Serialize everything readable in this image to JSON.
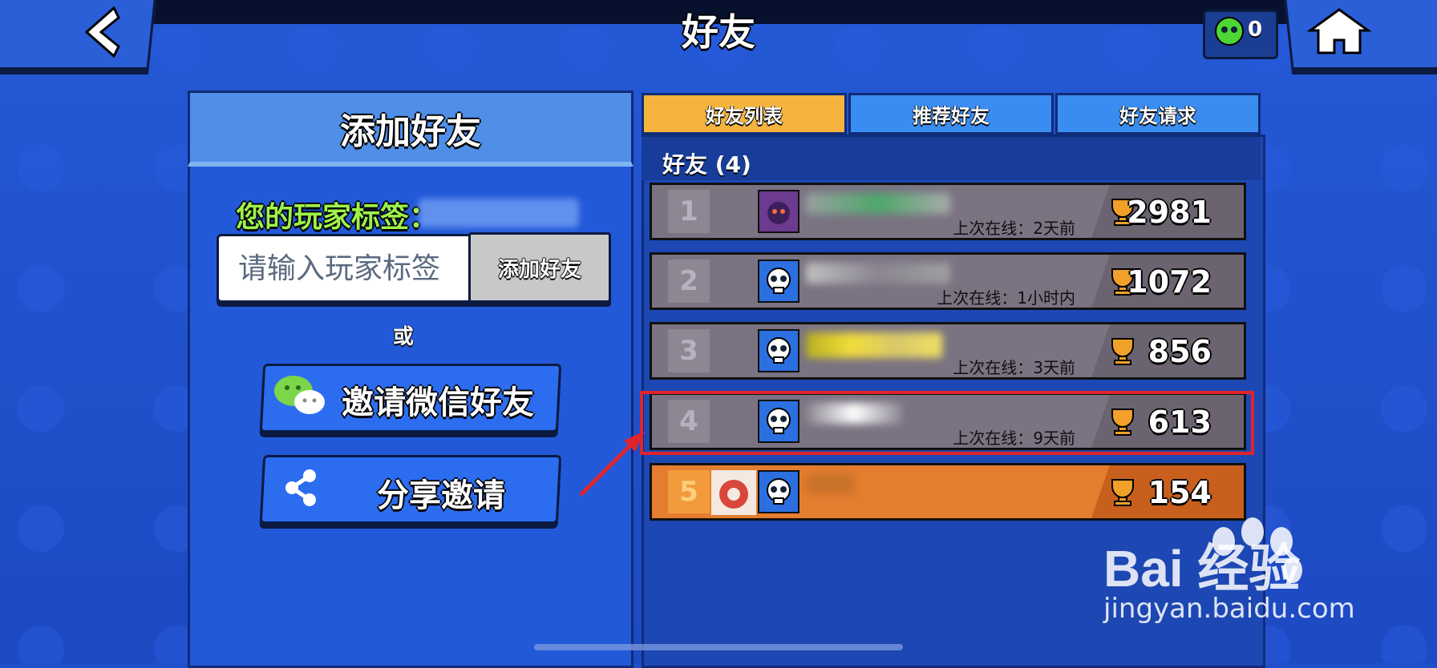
{
  "header": {
    "title": "好友",
    "back_icon": "back-arrow-icon",
    "home_icon": "home-icon",
    "token_count": "0"
  },
  "add_friend_panel": {
    "title": "添加好友",
    "tag_label": "您的玩家标签：",
    "input_placeholder": "请输入玩家标签",
    "add_button": "添加好友",
    "or_text": "或",
    "wechat_button": "邀请微信好友",
    "share_button": "分享邀请"
  },
  "tabs": [
    {
      "label": "好友列表",
      "active": true
    },
    {
      "label": "推荐好友",
      "active": false
    },
    {
      "label": "好友请求",
      "active": false
    }
  ],
  "friends": {
    "header": "好友 (4)",
    "rows": [
      {
        "rank": "1",
        "last_online": "上次在线：2天前",
        "trophies": "2981"
      },
      {
        "rank": "2",
        "last_online": "上次在线：1小时内",
        "trophies": "1072"
      },
      {
        "rank": "3",
        "last_online": "上次在线：3天前",
        "trophies": "856"
      },
      {
        "rank": "4",
        "last_online": "上次在线：9天前",
        "trophies": "613"
      },
      {
        "rank": "5",
        "last_online": "",
        "trophies": "154"
      }
    ]
  },
  "watermark": {
    "brand": "Bai 经验",
    "url": "jingyan.baidu.com"
  },
  "colors": {
    "active_tab": "#f4b33c",
    "inactive_tab": "#3b8cf0",
    "self_row": "#e57d2f",
    "highlight": "#e0242e",
    "tag_label": "#9ef24a"
  }
}
